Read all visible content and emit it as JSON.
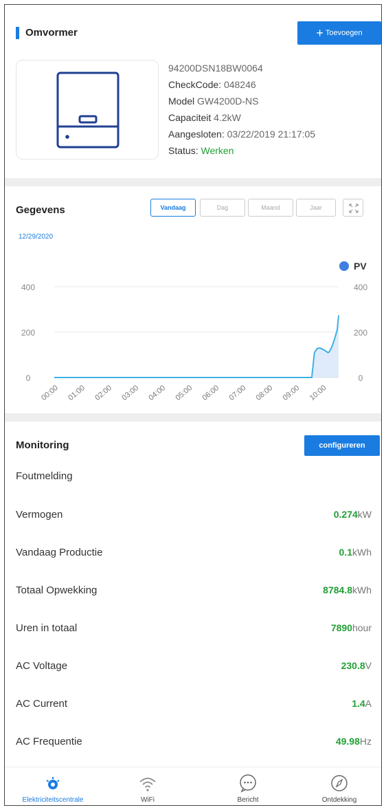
{
  "inverter": {
    "title": "Omvormer",
    "add_label": "Toevoegen",
    "serial": "94200DSN18BW0064",
    "checkcode_label": "CheckCode:",
    "checkcode_value": "048246",
    "model_label": "Model",
    "model_value": "GW4200D-NS",
    "capacity_label": "Capaciteit",
    "capacity_value": "4.2kW",
    "connected_label": "Aangesloten:",
    "connected_value": "03/22/2019 21:17:05",
    "status_label": "Status:",
    "status_value": "Werken"
  },
  "data_section": {
    "title": "Gegevens",
    "tabs": [
      "Vandaag",
      "Dag",
      "Maand",
      "Jaar"
    ],
    "active_tab": "Vandaag",
    "date": "12/29/2020"
  },
  "chart_data": {
    "type": "area",
    "legend": "PV",
    "x": [
      "00:00",
      "01:00",
      "02:00",
      "03:00",
      "04:00",
      "05:00",
      "06:00",
      "07:00",
      "08:00",
      "09:00",
      "10:00"
    ],
    "ylim": [
      0,
      400
    ],
    "yticks": [
      "400",
      "200",
      "0"
    ],
    "series": [
      {
        "name": "PV",
        "points": [
          [
            0,
            0
          ],
          [
            9.6,
            0
          ],
          [
            9.7,
            110
          ],
          [
            9.8,
            128
          ],
          [
            9.9,
            130
          ],
          [
            10.0,
            125
          ],
          [
            10.1,
            118
          ],
          [
            10.2,
            110
          ],
          [
            10.25,
            112
          ],
          [
            10.35,
            135
          ],
          [
            10.45,
            170
          ],
          [
            10.55,
            210
          ],
          [
            10.6,
            274
          ]
        ]
      }
    ],
    "colors": {
      "line": "#3eb0e6",
      "fill": "#dbe9f9",
      "legend_dot": "#3f7fe0"
    }
  },
  "monitoring": {
    "title": "Monitoring",
    "config_label": "configureren",
    "error_label": "Foutmelding",
    "rows": [
      {
        "label": "Vermogen",
        "value": "0.274",
        "unit": "kW"
      },
      {
        "label": "Vandaag Productie",
        "value": "0.1",
        "unit": "kWh"
      },
      {
        "label": "Totaal Opwekking",
        "value": "8784.8",
        "unit": "kWh"
      },
      {
        "label": "Uren in totaal",
        "value": "7890",
        "unit": "hour"
      },
      {
        "label": "AC Voltage",
        "value": "230.8",
        "unit": "V"
      },
      {
        "label": "AC Current",
        "value": "1.4",
        "unit": "A"
      },
      {
        "label": "AC Frequentie",
        "value": "49.98",
        "unit": "Hz"
      }
    ]
  },
  "nav": {
    "items": [
      {
        "label": "Elektriciteitscentrale",
        "icon": "power-station-icon",
        "active": true
      },
      {
        "label": "WiFi",
        "icon": "wifi-icon",
        "active": false
      },
      {
        "label": "Bericht",
        "icon": "message-icon",
        "active": false
      },
      {
        "label": "Ontdekking",
        "icon": "compass-icon",
        "active": false
      }
    ]
  },
  "colors": {
    "accent": "#1a7ce0",
    "green": "#21a035"
  }
}
